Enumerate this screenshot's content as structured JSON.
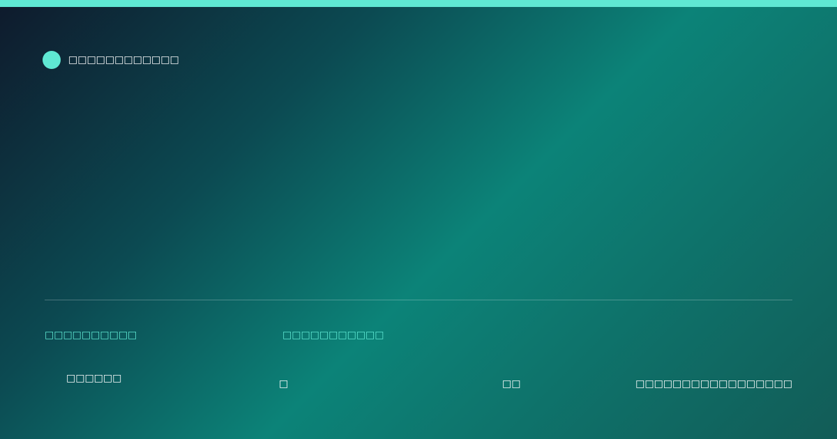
{
  "colors": {
    "accent": "#5fe8d3",
    "background_start": "#0e1a2c",
    "background_mid": "#0c8378",
    "background_end": "#125c57",
    "text": "#ffffff"
  },
  "brand": {
    "icon": "circle-dot-icon",
    "name": "□□□□□□□□□□□□"
  },
  "footer": {
    "label_left": "□□□□□□□□□□",
    "label_mid": "□□□□□□□□□□□",
    "value_1": "□□□□□□",
    "value_2": "□",
    "value_3": "□□",
    "value_4": "□□□□□□□□□□□□□□□□□"
  }
}
